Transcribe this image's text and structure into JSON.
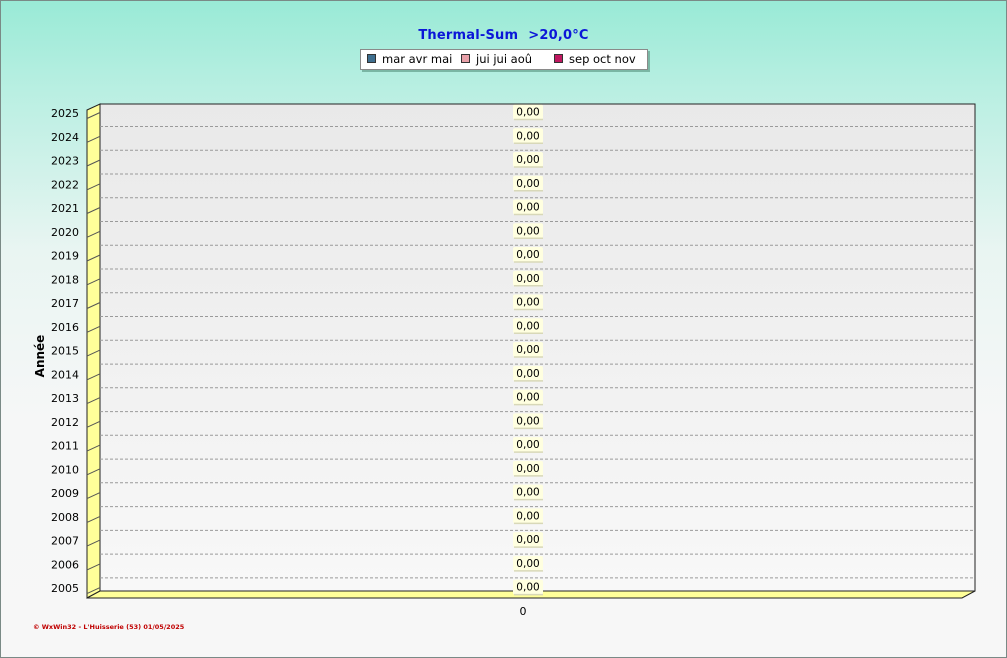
{
  "chart_data": {
    "type": "bar",
    "orientation": "horizontal",
    "title": "Thermal-Sum",
    "title_unit": ">20,0°C",
    "ylabel": "Année",
    "categories": [
      "2025",
      "2024",
      "2023",
      "2022",
      "2021",
      "2020",
      "2019",
      "2018",
      "2017",
      "2016",
      "2015",
      "2014",
      "2013",
      "2012",
      "2011",
      "2010",
      "2009",
      "2008",
      "2007",
      "2006",
      "2005"
    ],
    "series": [
      {
        "name": "mar avr mai",
        "color": "#3f6f8f",
        "values": [
          0,
          0,
          0,
          0,
          0,
          0,
          0,
          0,
          0,
          0,
          0,
          0,
          0,
          0,
          0,
          0,
          0,
          0,
          0,
          0,
          0
        ]
      },
      {
        "name": "jui jui aoû",
        "color": "#e8a0a8",
        "values": [
          0,
          0,
          0,
          0,
          0,
          0,
          0,
          0,
          0,
          0,
          0,
          0,
          0,
          0,
          0,
          0,
          0,
          0,
          0,
          0,
          0
        ]
      },
      {
        "name": "sep oct nov",
        "color": "#c01860",
        "values": [
          0,
          0,
          0,
          0,
          0,
          0,
          0,
          0,
          0,
          0,
          0,
          0,
          0,
          0,
          0,
          0,
          0,
          0,
          0,
          0,
          0
        ]
      }
    ],
    "totals_labels": [
      "0,00",
      "0,00",
      "0,00",
      "0,00",
      "0,00",
      "0,00",
      "0,00",
      "0,00",
      "0,00",
      "0,00",
      "0,00",
      "0,00",
      "0,00",
      "0,00",
      "0,00",
      "0,00",
      "0,00",
      "0,00",
      "0,00",
      "0,00",
      "0,00"
    ],
    "x_tick_labels": [
      "0"
    ],
    "legend_position": "top-center",
    "grid": true,
    "grid_style": "dashed"
  },
  "footer": "© WxWin32 - L'Huisserie (53)  01/05/2025",
  "colors": {
    "title": "#0b16d8",
    "footer": "#c00000",
    "floor": "#ffff99",
    "label_bg": "#ffffe0"
  }
}
